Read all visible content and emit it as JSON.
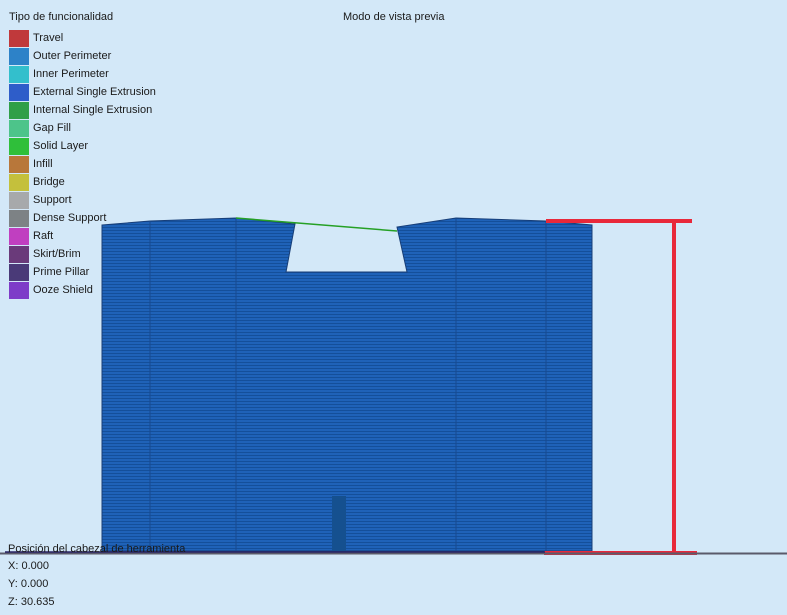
{
  "legend": {
    "title": "Tipo de funcionalidad",
    "items": [
      {
        "label": "Travel",
        "color": "#c0393b"
      },
      {
        "label": "Outer Perimeter",
        "color": "#2d82c8"
      },
      {
        "label": "Inner Perimeter",
        "color": "#33bfcc"
      },
      {
        "label": "External Single Extrusion",
        "color": "#2e5dc9"
      },
      {
        "label": "Internal Single Extrusion",
        "color": "#2f9f48"
      },
      {
        "label": "Gap Fill",
        "color": "#4dc48a"
      },
      {
        "label": "Solid Layer",
        "color": "#2fbf3a"
      },
      {
        "label": "Infill",
        "color": "#b8773a"
      },
      {
        "label": "Bridge",
        "color": "#c4c03c"
      },
      {
        "label": "Support",
        "color": "#a7a9ab"
      },
      {
        "label": "Dense Support",
        "color": "#7d8285"
      },
      {
        "label": "Raft",
        "color": "#c03fc0"
      },
      {
        "label": "Skirt/Brim",
        "color": "#6a3a7a"
      },
      {
        "label": "Prime Pillar",
        "color": "#4a3a78"
      },
      {
        "label": "Ooze Shield",
        "color": "#7e3cc8"
      }
    ]
  },
  "preview_mode": "Modo de vista previa",
  "toolhead": {
    "label": "Posición del cabezal de herramienta",
    "x": "X: 0.000",
    "y": "Y: 0.000",
    "z": "Z: 30.635"
  },
  "colors": {
    "background": "#d3e8f8",
    "model_fill": "#1f62b8",
    "model_lines": "#0f3f7e",
    "measure": "#e8283a",
    "travel_line": "#25a025"
  }
}
